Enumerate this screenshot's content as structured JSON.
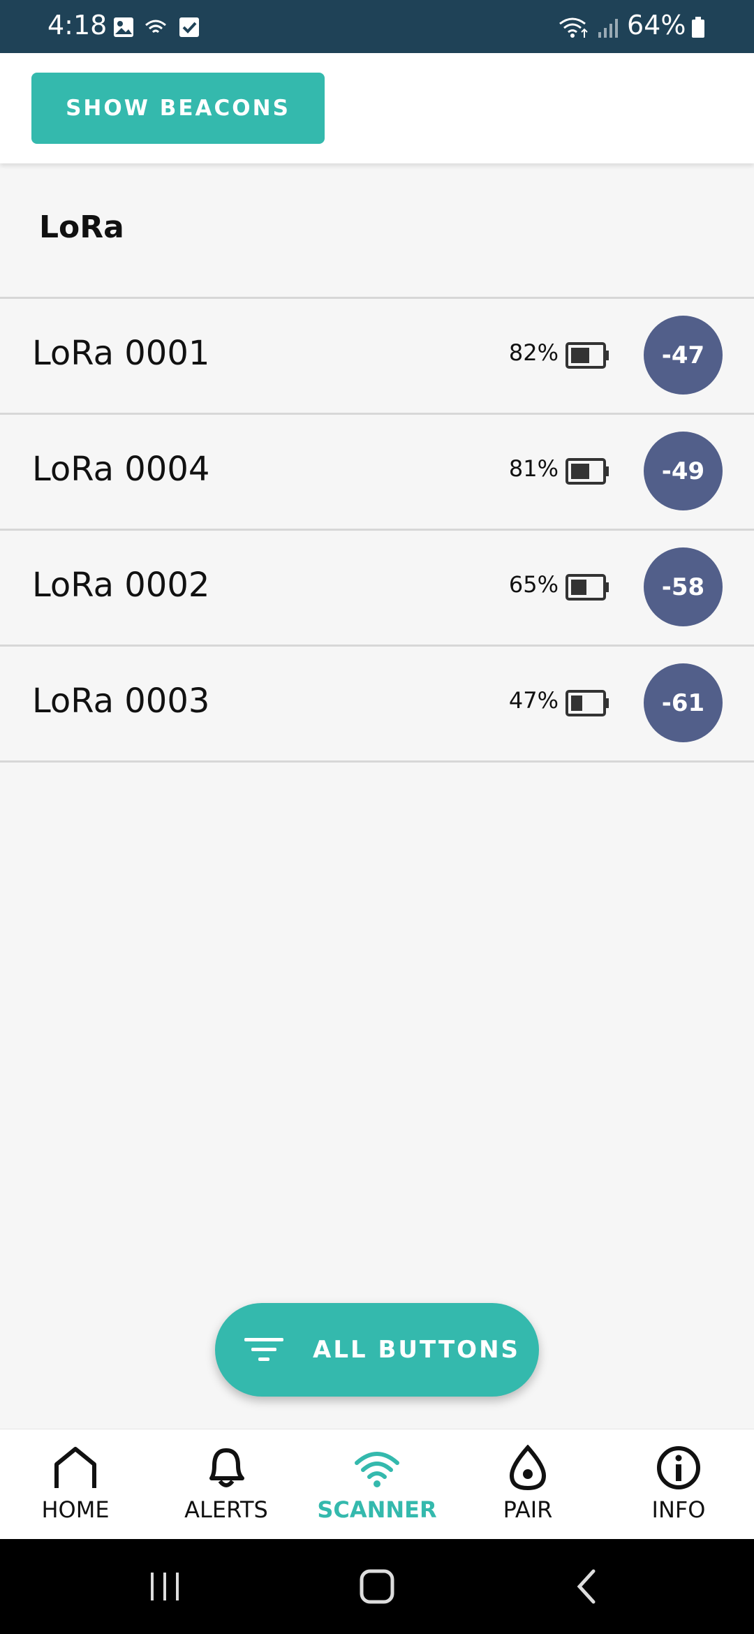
{
  "status_bar": {
    "time": "4:18",
    "battery_percent": "64%",
    "icons": [
      "image-icon",
      "hotspot-icon",
      "checkbox-icon",
      "wifi-icon",
      "signal-icon",
      "battery-icon"
    ]
  },
  "top_bar": {
    "show_beacons_label": "SHOW BEACONS"
  },
  "section": {
    "title": "LoRa"
  },
  "devices": [
    {
      "name": "LoRa 0001",
      "battery": "82%",
      "rssi": "-47"
    },
    {
      "name": "LoRa 0004",
      "battery": "81%",
      "rssi": "-49"
    },
    {
      "name": "LoRa 0002",
      "battery": "65%",
      "rssi": "-58"
    },
    {
      "name": "LoRa 0003",
      "battery": "47%",
      "rssi": "-61"
    }
  ],
  "fab": {
    "label": "ALL BUTTONS",
    "icon": "filter-icon"
  },
  "bottom_nav": {
    "items": [
      {
        "label": "HOME",
        "icon": "home-icon"
      },
      {
        "label": "ALERTS",
        "icon": "bell-icon"
      },
      {
        "label": "SCANNER",
        "icon": "scanner-wifi-icon",
        "active": true
      },
      {
        "label": "PAIR",
        "icon": "pair-icon"
      },
      {
        "label": "INFO",
        "icon": "info-icon"
      }
    ]
  },
  "colors": {
    "accent": "#34b9ad",
    "rssi_badge": "#525f8a",
    "status_bar": "#1f4257"
  }
}
